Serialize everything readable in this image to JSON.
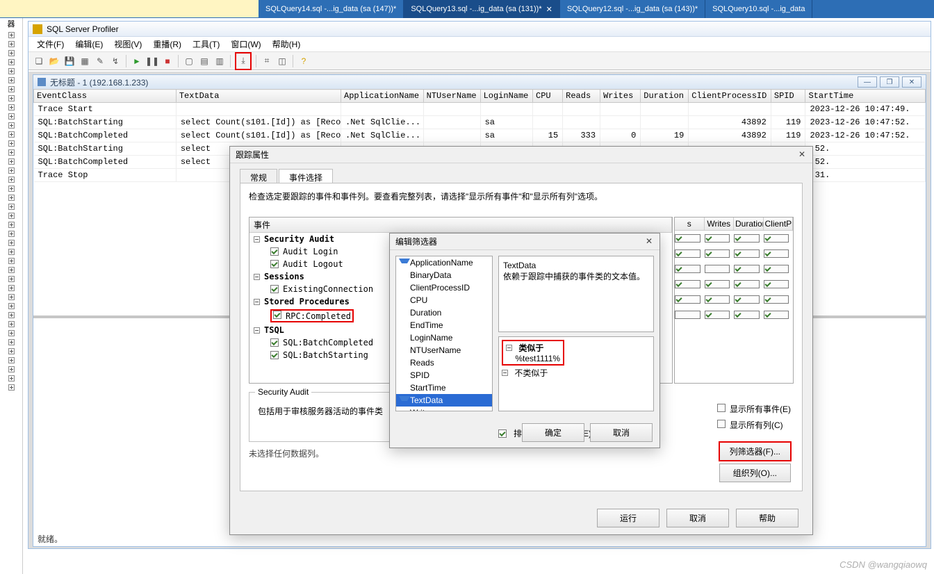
{
  "sqlTabs": {
    "spacerLabel": "器",
    "tabs": [
      {
        "label": "SQLQuery14.sql -...ig_data (sa (147))*",
        "active": false
      },
      {
        "label": "SQLQuery13.sql -...ig_data (sa (131))*",
        "active": true
      },
      {
        "label": "SQLQuery12.sql -...ig_data (sa (143))*",
        "active": false
      },
      {
        "label": "SQLQuery10.sql -...ig_data",
        "active": false
      }
    ]
  },
  "profiler": {
    "title": "SQL Server Profiler",
    "menus": [
      "文件(F)",
      "编辑(E)",
      "视图(V)",
      "重播(R)",
      "工具(T)",
      "窗口(W)",
      "帮助(H)"
    ],
    "childTitle": "无标题 - 1 (192.168.1.233)",
    "status": "就绪。"
  },
  "grid": {
    "headers": [
      "EventClass",
      "TextData",
      "ApplicationName",
      "NTUserName",
      "LoginName",
      "CPU",
      "Reads",
      "Writes",
      "Duration",
      "ClientProcessID",
      "SPID",
      "StartTime"
    ],
    "rows": [
      {
        "EventClass": "Trace Start",
        "TextData": "",
        "ApplicationName": "",
        "NTUserName": "",
        "LoginName": "",
        "CPU": "",
        "Reads": "",
        "Writes": "",
        "Duration": "",
        "ClientProcessID": "",
        "SPID": "",
        "StartTime": "2023-12-26 10:47:49."
      },
      {
        "EventClass": "SQL:BatchStarting",
        "TextData": "select  Count(s101.[Id]) as [Reco...",
        "ApplicationName": ".Net SqlClie...",
        "NTUserName": "",
        "LoginName": "sa",
        "CPU": "",
        "Reads": "",
        "Writes": "",
        "Duration": "",
        "ClientProcessID": "43892",
        "SPID": "119",
        "StartTime": "2023-12-26 10:47:52."
      },
      {
        "EventClass": "SQL:BatchCompleted",
        "TextData": "select  Count(s101.[Id]) as [Reco...",
        "ApplicationName": ".Net SqlClie...",
        "NTUserName": "",
        "LoginName": "sa",
        "CPU": "15",
        "Reads": "333",
        "Writes": "0",
        "Duration": "19",
        "ClientProcessID": "43892",
        "SPID": "119",
        "StartTime": "2023-12-26 10:47:52."
      },
      {
        "EventClass": "SQL:BatchStarting",
        "TextData": "select",
        "ApplicationName": "",
        "NTUserName": "",
        "LoginName": "",
        "CPU": "",
        "Reads": "",
        "Writes": "",
        "Duration": "",
        "ClientProcessID": "",
        "SPID": "",
        "StartTime": ":52."
      },
      {
        "EventClass": "SQL:BatchCompleted",
        "TextData": "select",
        "ApplicationName": "",
        "NTUserName": "",
        "LoginName": "",
        "CPU": "",
        "Reads": "",
        "Writes": "",
        "Duration": "",
        "ClientProcessID": "",
        "SPID": "",
        "StartTime": ":52."
      },
      {
        "EventClass": "Trace Stop",
        "TextData": "",
        "ApplicationName": "",
        "NTUserName": "",
        "LoginName": "",
        "CPU": "",
        "Reads": "",
        "Writes": "",
        "Duration": "",
        "ClientProcessID": "",
        "SPID": "",
        "StartTime": ":31."
      }
    ]
  },
  "propsDialog": {
    "title": "跟踪属性",
    "tabs": [
      "常规",
      "事件选择"
    ],
    "activeTab": 1,
    "hint": "检查选定要跟踪的事件和事件列。要查看完整列表，请选择\"显示所有事件\"和\"显示所有列\"选项。",
    "eventsHeader": "事件",
    "extraCols": [
      "s",
      "Writes",
      "Duration",
      "ClientProce"
    ],
    "categories": [
      {
        "name": "Security Audit",
        "items": [
          {
            "label": "Audit Login",
            "checked": true
          },
          {
            "label": "Audit Logout",
            "checked": true
          }
        ]
      },
      {
        "name": "Sessions",
        "items": [
          {
            "label": "ExistingConnection",
            "checked": true
          }
        ]
      },
      {
        "name": "Stored Procedures",
        "items": [
          {
            "label": "RPC:Completed",
            "checked": true,
            "highlight": true
          }
        ]
      },
      {
        "name": "TSQL",
        "items": [
          {
            "label": "SQL:BatchCompleted",
            "checked": true
          },
          {
            "label": "SQL:BatchStarting",
            "checked": true
          }
        ]
      }
    ],
    "groupTitle": "Security Audit",
    "groupDesc": "包括用于审核服务器活动的事件类",
    "noSelect": "未选择任何数据列。",
    "showAllEvents": "显示所有事件(E)",
    "showAllCols": "显示所有列(C)",
    "colFilterBtn": "列筛选器(F)...",
    "orgColsBtn": "组织列(O)...",
    "runBtn": "运行",
    "cancelBtn": "取消",
    "helpBtn": "帮助"
  },
  "filterDialog": {
    "title": "编辑筛选器",
    "columns": [
      "ApplicationName",
      "BinaryData",
      "ClientProcessID",
      "CPU",
      "Duration",
      "EndTime",
      "LoginName",
      "NTUserName",
      "Reads",
      "SPID",
      "StartTime",
      "TextData",
      "Writes"
    ],
    "selected": "TextData",
    "funnel": [
      "ApplicationName",
      "TextData"
    ],
    "descTitle": "TextData",
    "descBody": "依赖于跟踪中捕获的事件类的文本值。",
    "likeLabel": "类似于",
    "likeValue": "%test1111%",
    "notLikeLabel": "不类似于",
    "excludeLabel": "排除不包含值的行(E)",
    "okBtn": "确定",
    "cancelBtn": "取消"
  },
  "watermark": "CSDN @wangqiaowq"
}
